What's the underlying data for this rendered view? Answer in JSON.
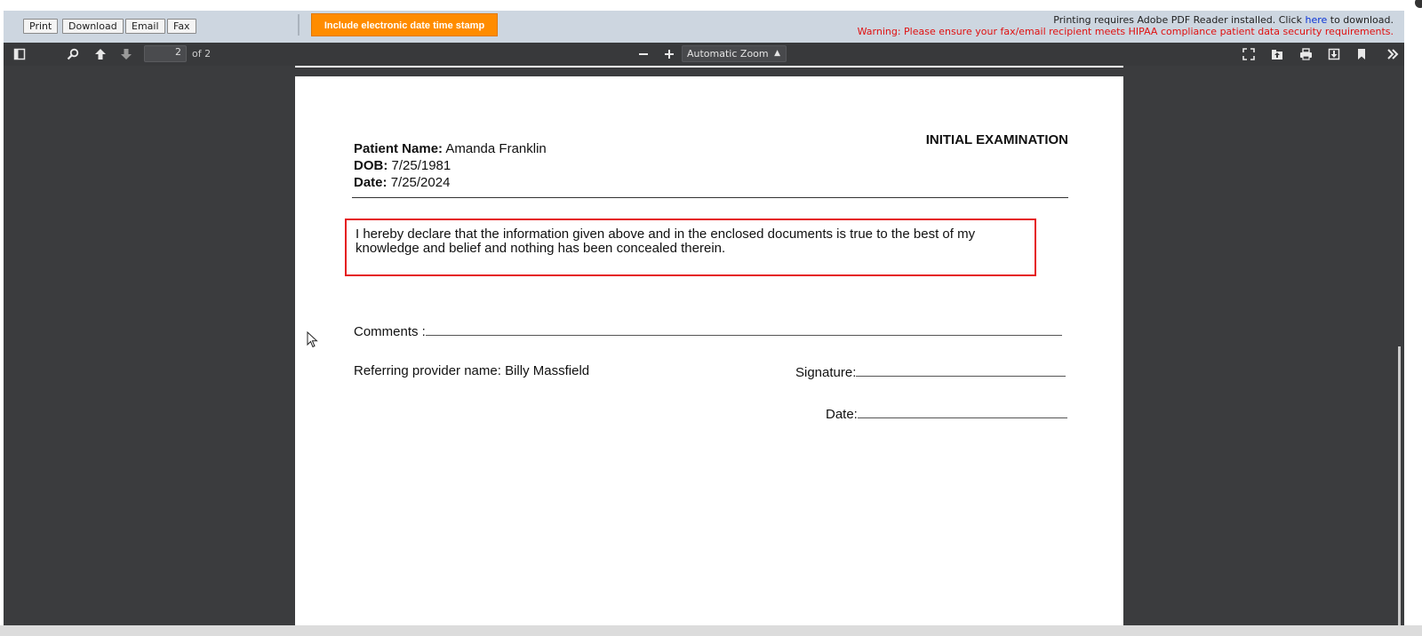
{
  "toolbar": {
    "print": "Print",
    "download": "Download",
    "email": "Email",
    "fax": "Fax",
    "stamp_button": "Include electronic date time stamp",
    "notice_prefix": "Printing requires Adobe PDF Reader installed. Click ",
    "notice_link": "here",
    "notice_suffix": " to download.",
    "warning": "Warning: Please ensure your fax/email recipient meets HIPAA compliance patient data security requirements."
  },
  "pdf_toolbar": {
    "page_number": "2",
    "page_total": "of 2",
    "zoom": "Automatic Zoom",
    "icons": [
      "sidebar-toggle-icon",
      "search-icon",
      "page-up-icon",
      "page-down-icon",
      "zoom-out-icon",
      "zoom-in-icon",
      "presentation-mode-icon",
      "open-file-icon",
      "print-icon",
      "download-icon",
      "bookmark-icon",
      "more-tools-icon"
    ]
  },
  "document": {
    "patient_name_label": "Patient Name:",
    "patient_name": "Amanda Franklin",
    "dob_label": "DOB:",
    "dob": "7/25/1981",
    "date_label": "Date:",
    "date": "7/25/2024",
    "title": "INITIAL EXAMINATION",
    "declaration": "I hereby declare that the information given above and in the enclosed documents is true to the best of my knowledge and belief and nothing has been concealed therein.",
    "comments_label": "Comments :",
    "referring_label": "Referring provider name:",
    "referring_name": "Billy Massfield",
    "signature_label": "Signature:",
    "sign_date_label": "Date:"
  },
  "colors": {
    "stamp_button": "#ff8c00",
    "warning_text": "#e01010",
    "declaration_border": "#e5191c",
    "viewer_background": "#3b3c3e"
  }
}
